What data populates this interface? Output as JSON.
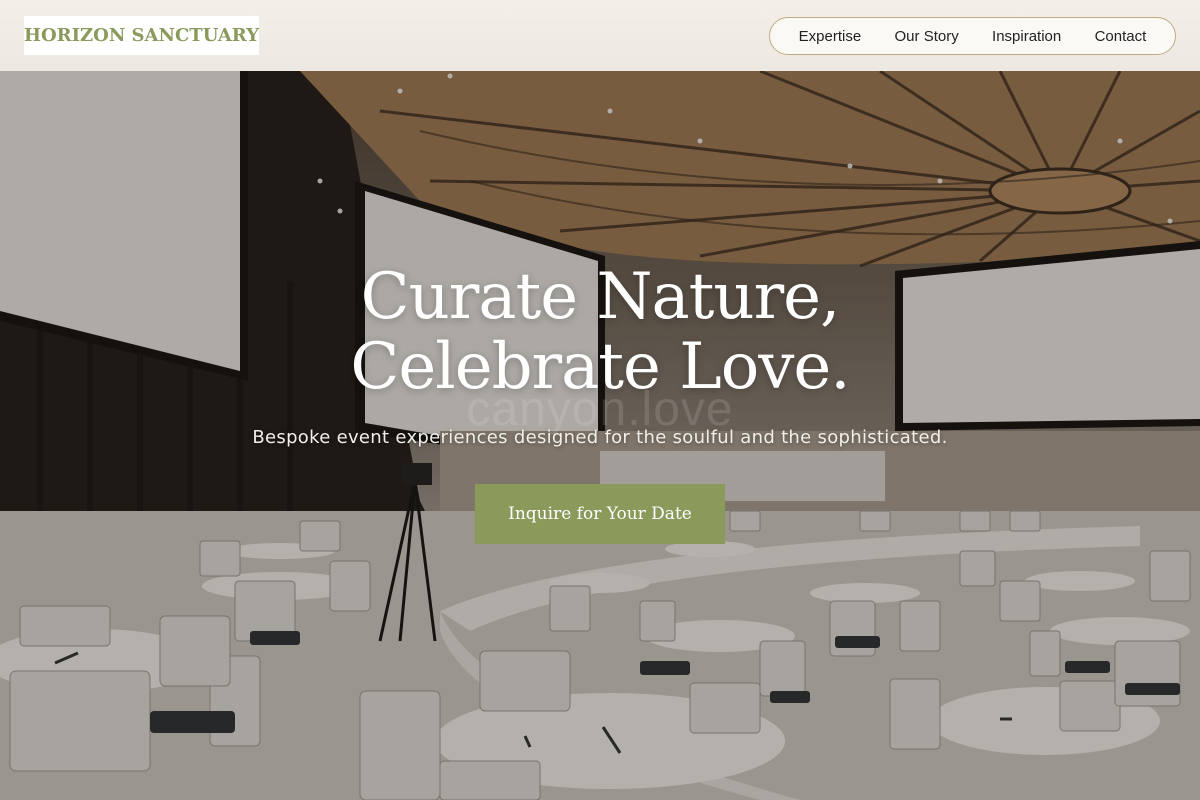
{
  "brand": {
    "name": "HORIZON SANCTUARY"
  },
  "nav": {
    "items": [
      {
        "label": "Expertise"
      },
      {
        "label": "Our Story"
      },
      {
        "label": "Inspiration"
      },
      {
        "label": "Contact"
      }
    ]
  },
  "hero": {
    "headline_line1": "Curate Nature,",
    "headline_line2": "Celebrate Love.",
    "watermark": "canyon.love",
    "tagline": "Bespoke event experiences designed for the soulful and the sophisticated.",
    "cta_label": "Inquire for Your Date"
  },
  "colors": {
    "accent": "#8a9a5b",
    "nav_border": "#c2ab84",
    "header_bg": "#f0ece6"
  }
}
